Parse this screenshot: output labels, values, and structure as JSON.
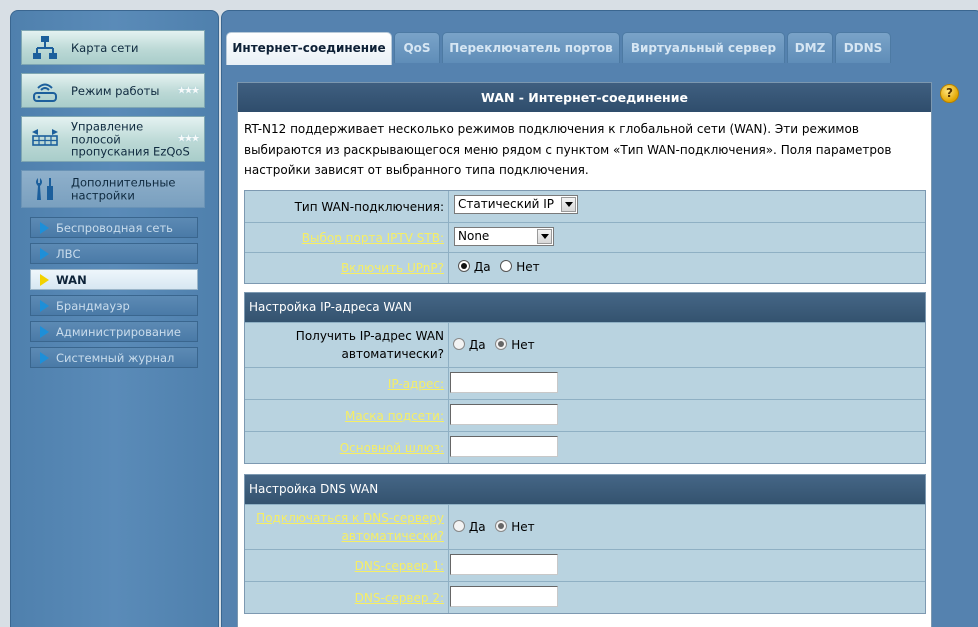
{
  "sidebar": {
    "menu": [
      {
        "label": "Карта сети",
        "icon": "network-map-icon"
      },
      {
        "label": "Режим работы",
        "icon": "router-icon"
      },
      {
        "label": "Управление полосой пропускания EzQoS",
        "label_lines": [
          "Управление",
          "полосой",
          "пропускания EzQoS"
        ],
        "icon": "bandwidth-icon"
      },
      {
        "label": "Дополнительные настройки",
        "label_lines": [
          "Дополнительные",
          "настройки"
        ],
        "icon": "tools-icon"
      }
    ],
    "submenu": [
      {
        "label": "Беспроводная сеть"
      },
      {
        "label": "ЛВС"
      },
      {
        "label": "WAN"
      },
      {
        "label": "Брандмауэр"
      },
      {
        "label": "Администрирование"
      },
      {
        "label": "Системный журнал"
      }
    ],
    "active_submenu": "WAN"
  },
  "tabs": [
    {
      "label": "Интернет-соединение"
    },
    {
      "label": "QoS"
    },
    {
      "label": "Переключатель портов"
    },
    {
      "label": "Виртуальный сервер"
    },
    {
      "label": "DMZ"
    },
    {
      "label": "DDNS"
    }
  ],
  "active_tab": "Интернет-соединение",
  "content": {
    "title": "WAN - Интернет-соединение",
    "description": "RT-N12 поддерживает несколько режимов подключения к глобальной сети (WAN). Эти режимов выбираются из раскрывающегося меню рядом с пунктом «Тип WAN-подключения». Поля параметров настройки зависят от выбранного типа подключения."
  },
  "general": {
    "wan_type": {
      "label": "Тип WAN-подключения:",
      "value": "Статический IP"
    },
    "iptv_port": {
      "label": "Выбор порта IPTV STB:",
      "value": "None"
    },
    "upnp": {
      "label": "Включить UPnP?",
      "options": [
        "Да",
        "Нет"
      ],
      "selected": "Да"
    }
  },
  "wan_ip": {
    "header": "Настройка IP-адреса WAN",
    "auto": {
      "label": "Получить IP-адрес WAN автоматически?",
      "options": [
        "Да",
        "Нет"
      ],
      "selected": "Нет"
    },
    "ip_address": {
      "label": "IP-адрес:",
      "value": ""
    },
    "subnet_mask": {
      "label": "Маска подсети:",
      "value": ""
    },
    "gateway": {
      "label": "Основной шлюз:",
      "value": ""
    }
  },
  "dns": {
    "header": "Настройка DNS WAN",
    "auto": {
      "label": "Подключаться к DNS-серверу автоматически?",
      "options": [
        "Да",
        "Нет"
      ],
      "selected": "Нет"
    },
    "dns1": {
      "label": "DNS-сервер 1:",
      "value": ""
    },
    "dns2": {
      "label": "DNS-сервер 2:",
      "value": ""
    }
  },
  "help": {
    "symbol": "?"
  }
}
